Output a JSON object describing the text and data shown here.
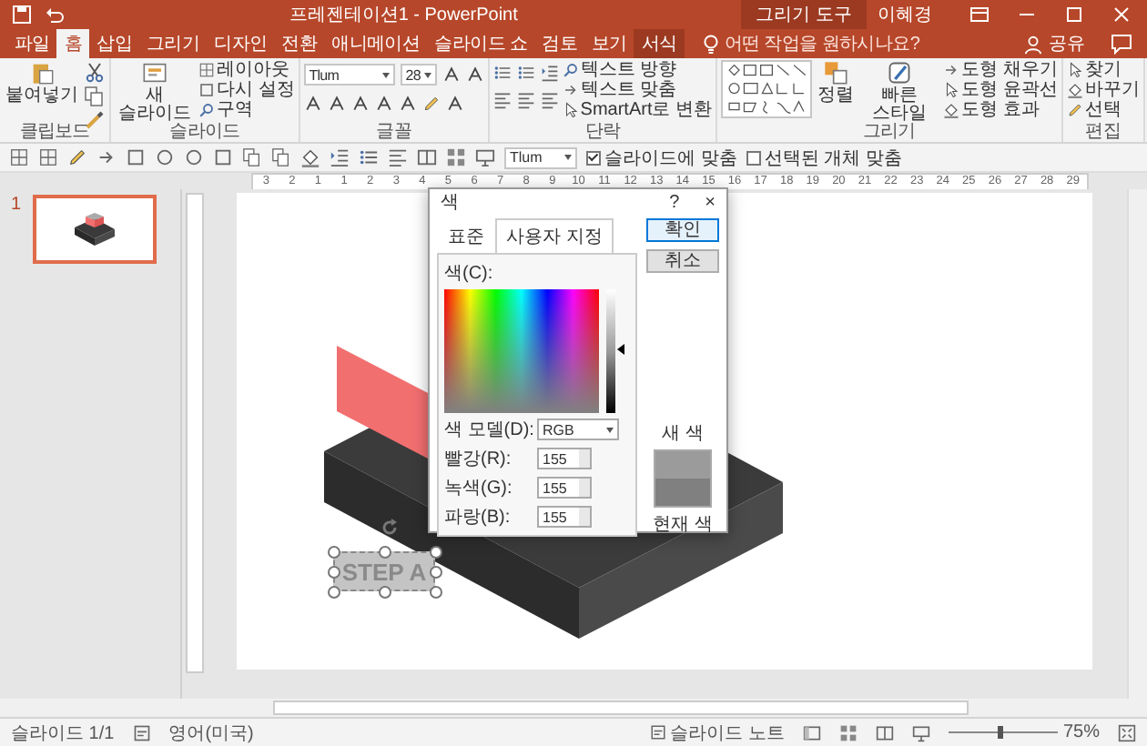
{
  "window": {
    "title": "프레젠테이션1 - PowerPoint",
    "context_label": "그리기 도구",
    "user": "이혜경"
  },
  "tabs": [
    {
      "label": "파일",
      "selected": false,
      "kind": "main"
    },
    {
      "label": "홈",
      "selected": true,
      "kind": "main"
    },
    {
      "label": "삽입",
      "selected": false,
      "kind": "main"
    },
    {
      "label": "그리기",
      "selected": false,
      "kind": "main"
    },
    {
      "label": "디자인",
      "selected": false,
      "kind": "main"
    },
    {
      "label": "전환",
      "selected": false,
      "kind": "main"
    },
    {
      "label": "애니메이션",
      "selected": false,
      "kind": "main"
    },
    {
      "label": "슬라이드 쇼",
      "selected": false,
      "kind": "main"
    },
    {
      "label": "검토",
      "selected": false,
      "kind": "main"
    },
    {
      "label": "보기",
      "selected": false,
      "kind": "main"
    },
    {
      "label": "서식",
      "selected": false,
      "kind": "context"
    }
  ],
  "tell_me": {
    "placeholder": "어떤 작업을 원하시나요?"
  },
  "share": "공유",
  "ribbon_groups": [
    {
      "label": "클립보드",
      "items": [
        {
          "kind": "large",
          "label": "붙여넣기"
        },
        {
          "kind": "icons"
        }
      ]
    },
    {
      "label": "슬라이드",
      "items": [
        {
          "kind": "large",
          "label": "새 슬라이드"
        },
        {
          "kind": "stack",
          "labels": [
            "레이아웃",
            "다시 설정",
            "구역"
          ]
        }
      ]
    },
    {
      "label": "글꼴",
      "items": [
        {
          "kind": "font",
          "font": "Tlum",
          "size": "28"
        }
      ]
    },
    {
      "label": "단락",
      "items": [
        {
          "kind": "paragraph"
        },
        {
          "kind": "stack",
          "labels": [
            "텍스트 방향",
            "텍스트 맞춤",
            "SmartArt로 변환"
          ]
        }
      ]
    },
    {
      "label": "그리기",
      "items": [
        {
          "kind": "shapes"
        },
        {
          "kind": "large",
          "label": "정렬"
        },
        {
          "kind": "large",
          "label": "빠른 스타일"
        },
        {
          "kind": "stack",
          "labels": [
            "도형 채우기",
            "도형 윤곽선",
            "도형 효과"
          ]
        }
      ]
    },
    {
      "label": "편집",
      "items": [
        {
          "kind": "stack",
          "labels": [
            "찾기",
            "바꾸기",
            "선택"
          ]
        }
      ]
    }
  ],
  "toolbar": {
    "font": "Tlum",
    "checkboxes": [
      {
        "label": "슬라이드에 맞춤",
        "checked": true
      },
      {
        "label": "선택된 개체 맞춤",
        "checked": false
      }
    ]
  },
  "ruler": [
    "3",
    "2",
    "1",
    "1",
    "2",
    "3",
    "4",
    "5",
    "6",
    "7",
    "8",
    "9",
    "10",
    "11",
    "12",
    "13",
    "14",
    "15",
    "16",
    "17",
    "18",
    "19",
    "20",
    "21",
    "22",
    "23",
    "24",
    "25",
    "26",
    "27",
    "28",
    "29"
  ],
  "thumbnails": [
    {
      "number": "1",
      "selected": true
    }
  ],
  "slide": {
    "text_box": "STEP A"
  },
  "dialog": {
    "title": "색",
    "help": "?",
    "close": "×",
    "tabs": [
      {
        "label": "표준",
        "selected": false
      },
      {
        "label": "사용자 지정",
        "selected": true
      }
    ],
    "spectrum_label": "색(C):",
    "model": {
      "label": "색 모델(D):",
      "value": "RGB"
    },
    "fields": [
      {
        "label": "빨강(R):",
        "value": "155"
      },
      {
        "label": "녹색(G):",
        "value": "155"
      },
      {
        "label": "파랑(B):",
        "value": "155"
      }
    ],
    "buttons": [
      {
        "label": "확인",
        "default": true
      },
      {
        "label": "취소",
        "default": false
      }
    ],
    "swatches": [
      {
        "label": "새 색",
        "color": "#9b9b9b"
      },
      {
        "label": "현재 색",
        "color": "#808080"
      }
    ]
  },
  "status_bar": {
    "slide": "슬라이드 1/1",
    "language": "영어(미국)",
    "notes": "슬라이드 노트",
    "zoom": "75%",
    "zoom_slider": {
      "level": 0.45
    }
  }
}
